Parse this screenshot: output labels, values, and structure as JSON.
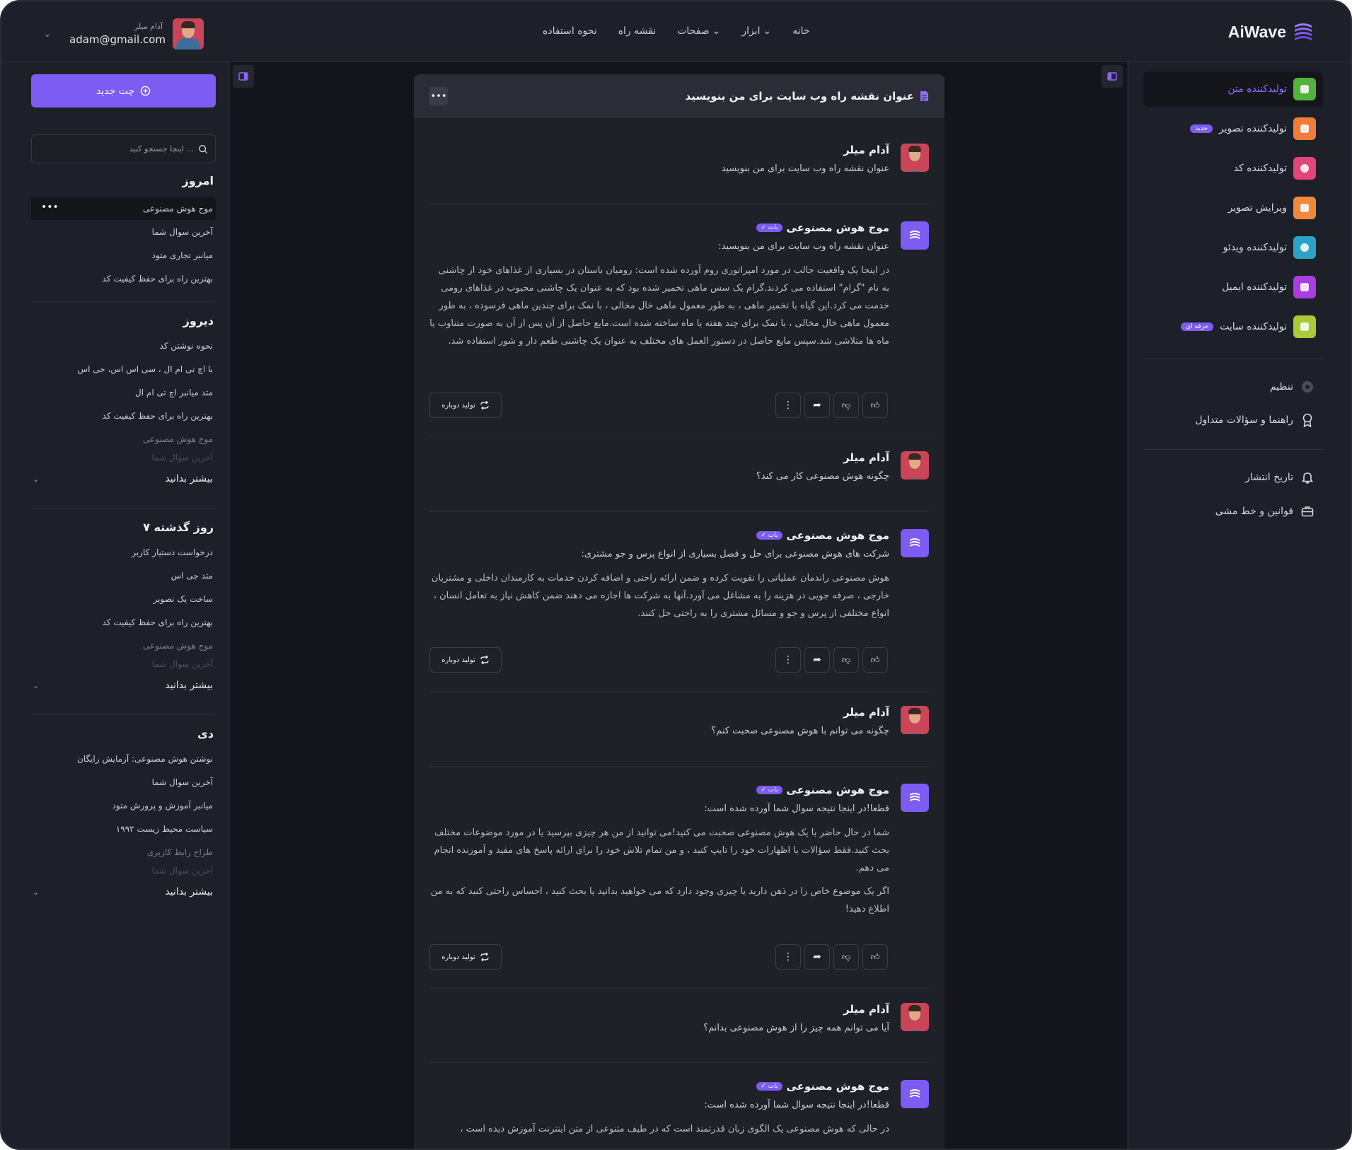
{
  "brand": {
    "name": "AiWave"
  },
  "nav": [
    {
      "label": "خانه",
      "caret": false
    },
    {
      "label": "ابزار",
      "caret": true
    },
    {
      "label": "صفحات",
      "caret": true
    },
    {
      "label": "نقشه راه",
      "caret": false
    },
    {
      "label": "نحوه استفاده",
      "caret": false
    }
  ],
  "user": {
    "name": "آدام میلر",
    "email": "adam@gmail.com"
  },
  "left_sidebar": {
    "new_chat_label": "چت جدید",
    "search_placeholder": "اینجا جستجو کنید ...",
    "groups": [
      {
        "title": "امروز",
        "items": [
          "موج هوش مصنوعی",
          "آخرین سوال شما",
          "میانبر تجاری متود",
          "بهترین راه برای حفظ کیفیت کد"
        ],
        "more": null
      },
      {
        "title": "دیروز",
        "items": [
          "نحوه نوشتن کد",
          "با اچ تی ام ال ، سی اس اس، جی اس",
          "متد میانبر اچ تی ام ال",
          "بهترین راه برای حفظ کیفیت کد",
          "موج هوش مصنوعی",
          "آخرین سوال شما"
        ],
        "more": "بیشتر بدانید"
      },
      {
        "title": "۷ روز گذشته",
        "items": [
          "درخواست دستیار کاربر",
          "متد جی اس",
          "ساخت یک تصویر",
          "بهترین راه برای حفظ کیفیت کد",
          "موج هوش مصنوعی",
          "آخرین سوال شما"
        ],
        "more": "بیشتر بدانید"
      },
      {
        "title": "دی",
        "items": [
          "نوشتن هوش مصنوعی: آزمایش رایگان",
          "آخرین سوال شما",
          "میانبر آموزش و پرورش متود",
          "سیاست محیط زیست ۱۹۹۲",
          "طراح رابط کاربری",
          "آخرین سوال شما"
        ],
        "more": "بیشتر بدانید"
      }
    ]
  },
  "chat": {
    "title": "عنوان نقشه راه وب سایت برای من بنویسید",
    "regenerate_label": "تولید دوباره",
    "bot_badge": "بات",
    "messages": [
      {
        "role": "user",
        "name": "آدام میلر",
        "text": "عنوان نقشه راه وب سایت برای من بنویسید"
      },
      {
        "role": "bot",
        "name": "موج هوش مصنوعی",
        "intro": "عنوان نقشه راه وب سایت برای من بنویسید:",
        "paragraphs": [
          "در اینجا یک واقعیت جالب در مورد امپراتوری روم آورده شده است: رومیان باستان در بسیاری از غذاهای خود از چاشنی به نام \"گرام\" استفاده می کردند.گرام یک سس ماهی تخمیر شده بود که به عنوان یک چاشنی محبوب در غذاهای رومی خدمت می کرد.این گیاه با تخمیر ماهی ، به طور معمول ماهی خال مخالی ، با نمک برای چندین ماهی فرسوده ، به طور معمول ماهی خال مخالی ، با نمک برای چند هفته یا ماه ساخته شده است.مایع حاصل از آن پس از آن به صورت متناوب یا ماه ها متلاشی شد.سپس مایع حاصل در دستور العمل های مختلف به عنوان یک چاشنی طعم دار و شور استفاده شد."
        ]
      },
      {
        "role": "user",
        "name": "آدام میلر",
        "text": "چگونه هوش مصنوعی کار می کند؟"
      },
      {
        "role": "bot",
        "name": "موج هوش مصنوعی",
        "intro": "شرکت های هوش مصنوعی برای حل و فصل بسیاری از انواع پرس و جو مشتری:",
        "paragraphs": [
          "هوش مصنوعی راندمان عملیاتی را تقویت کرده و ضمن ارائه راحتی و اضافه کردن خدمات به کارمندان داخلی و مشتریان خارجی ، صرفه جویی در هزینه را به مشاغل می آورد.آنها به شرکت ها اجازه می دهند ضمن کاهش نیاز به تعامل انسان ، انواع مختلفی از پرس و جو و مسائل مشتری را به راحتی حل کنند."
        ]
      },
      {
        "role": "user",
        "name": "آدام میلر",
        "text": "چگونه می توانم با هوش مصنوعی صحبت کنم؟"
      },
      {
        "role": "bot",
        "name": "موج هوش مصنوعی",
        "intro": "قطعا!در اینجا نتیجه سوال شما آورده شده است:",
        "paragraphs": [
          "شما در حال حاضر با یک هوش مصنوعی صحبت می کنید!می توانید از من هر چیزی بپرسید یا در مورد موضوعات مختلف بحث کنید.فقط سؤالات یا اظهارات خود را تایپ کنید ، و من تمام تلاش خود را برای ارائه پاسخ های مفید و آموزنده انجام می دهم.",
          "اگر یک موضوع خاص را در ذهن دارید یا چیزی وجود دارد که می خواهید بدانید یا بحث کنید ، احساس راحتی کنید که به من اطلاع دهید!"
        ]
      },
      {
        "role": "user",
        "name": "آدام میلر",
        "text": "آیا می توانم همه چیز را از هوش مصنوعی بدانم؟"
      },
      {
        "role": "bot",
        "name": "موج هوش مصنوعی",
        "intro": "قطعا!در اینجا نتیجه سوال شما آورده شده است:",
        "paragraphs": [
          "در حالی که هوش مصنوعی یک الگوی زبان قدرتمند است که در طیف متنوعی از متن اینترنت آموزش دیده است ،"
        ]
      }
    ]
  },
  "right_sidebar": {
    "tools": [
      {
        "label": "تولیدکننده متن",
        "color": "#53b13d",
        "tag": null
      },
      {
        "label": "تولیدکننده تصویر",
        "color": "#ef7c3a",
        "tag": "جدید"
      },
      {
        "label": "تولیدکننده کد",
        "color": "#e2457a",
        "tag": null
      },
      {
        "label": "ویرایش تصویر",
        "color": "#ef8a3a",
        "tag": null
      },
      {
        "label": "تولیدکننده ویدئو",
        "color": "#2ba3c6",
        "tag": null
      },
      {
        "label": "تولیدکننده ایمیل",
        "color": "#a83de0",
        "tag": null
      },
      {
        "label": "تولیدکننده سایت",
        "color": "#a8c93a",
        "tag": "حرفه ای"
      }
    ],
    "links_1": [
      "تنظیم",
      "راهنما و سؤالات متداول"
    ],
    "links_2": [
      "تاریخ انتشار",
      "قوانین و خط مشی"
    ]
  }
}
